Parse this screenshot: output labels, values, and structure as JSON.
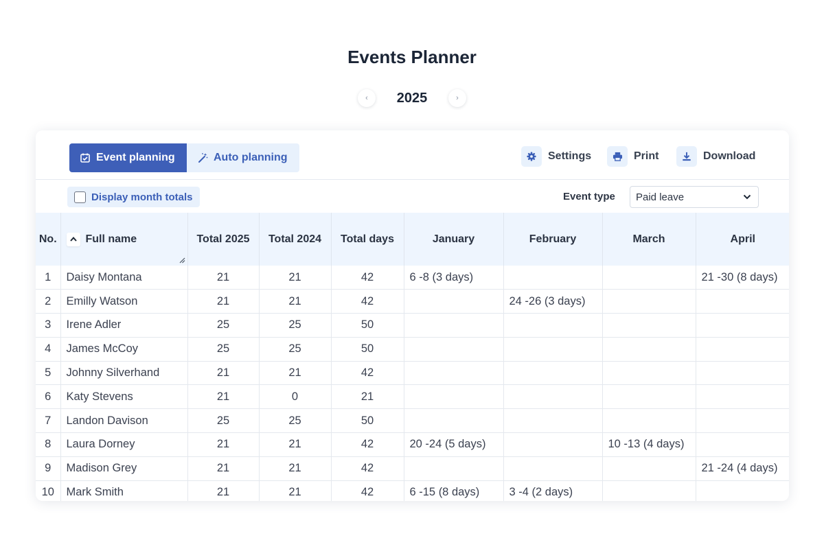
{
  "page": {
    "title": "Events Planner"
  },
  "year_nav": {
    "year": "2025",
    "prev_icon": "‹",
    "next_icon": "›"
  },
  "toolbar": {
    "tabs": [
      {
        "label": "Event planning",
        "icon": "calendar-check-icon",
        "active": true
      },
      {
        "label": "Auto planning",
        "icon": "magic-wand-icon",
        "active": false
      }
    ],
    "settings_label": "Settings",
    "print_label": "Print",
    "download_label": "Download"
  },
  "filters": {
    "month_totals_label": "Display month totals",
    "month_totals_checked": false,
    "event_type_label": "Event type",
    "event_type_value": "Paid leave"
  },
  "colors": {
    "accent": "#3e5fb8",
    "accent_light": "#e8f1fc",
    "header_bg": "#eef5fe"
  },
  "table": {
    "columns": [
      "No.",
      "Full name",
      "Total 2025",
      "Total 2024",
      "Total days",
      "January",
      "February",
      "March",
      "April"
    ],
    "rows": [
      [
        "1",
        "Daisy Montana",
        "21",
        "21",
        "42",
        "6 -8 (3 days)",
        "",
        "",
        "21 -30 (8 days)"
      ],
      [
        "2",
        "Emilly Watson",
        "21",
        "21",
        "42",
        "",
        "24 -26 (3 days)",
        "",
        ""
      ],
      [
        "3",
        "Irene Adler",
        "25",
        "25",
        "50",
        "",
        "",
        "",
        ""
      ],
      [
        "4",
        "James McCoy",
        "25",
        "25",
        "50",
        "",
        "",
        "",
        ""
      ],
      [
        "5",
        "Johnny Silverhand",
        "21",
        "21",
        "42",
        "",
        "",
        "",
        ""
      ],
      [
        "6",
        "Katy Stevens",
        "21",
        "0",
        "21",
        "",
        "",
        "",
        ""
      ],
      [
        "7",
        "Landon Davison",
        "25",
        "25",
        "50",
        "",
        "",
        "",
        ""
      ],
      [
        "8",
        "Laura Dorney",
        "21",
        "21",
        "42",
        "20 -24 (5 days)",
        "",
        "10 -13 (4 days)",
        ""
      ],
      [
        "9",
        "Madison Grey",
        "21",
        "21",
        "42",
        "",
        "",
        "",
        "21 -24 (4 days)"
      ],
      [
        "10",
        "Mark Smith",
        "21",
        "21",
        "42",
        "6 -15 (8 days)",
        "3 -4 (2 days)",
        "",
        ""
      ]
    ]
  }
}
